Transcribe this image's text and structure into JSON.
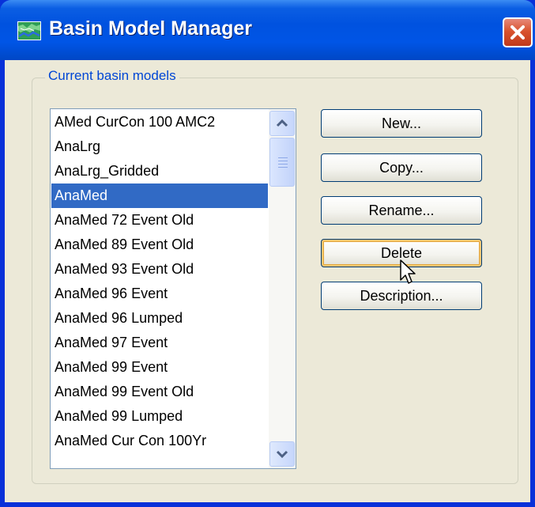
{
  "window": {
    "title": "Basin Model Manager",
    "app_icon": "basin-map-icon",
    "close_icon": "close-icon"
  },
  "group": {
    "legend": "Current basin models"
  },
  "basin_models": {
    "items": [
      "AMed CurCon 100 AMC2",
      "AnaLrg",
      "AnaLrg_Gridded",
      "AnaMed",
      "AnaMed 72 Event Old",
      "AnaMed 89 Event Old",
      "AnaMed 93 Event Old",
      "AnaMed 96 Event",
      "AnaMed 96 Lumped",
      "AnaMed 97 Event",
      "AnaMed 99 Event",
      "AnaMed 99 Event Old",
      "AnaMed 99 Lumped",
      "AnaMed Cur Con 100Yr"
    ],
    "selected": "AnaMed"
  },
  "buttons": {
    "new": "New...",
    "copy": "Copy...",
    "rename": "Rename...",
    "delete": "Delete",
    "description": "Description..."
  },
  "colors": {
    "title_bar": "#0054e3",
    "selection": "#316ac5",
    "legend_text": "#0046d5",
    "close_button": "#d9532e"
  }
}
